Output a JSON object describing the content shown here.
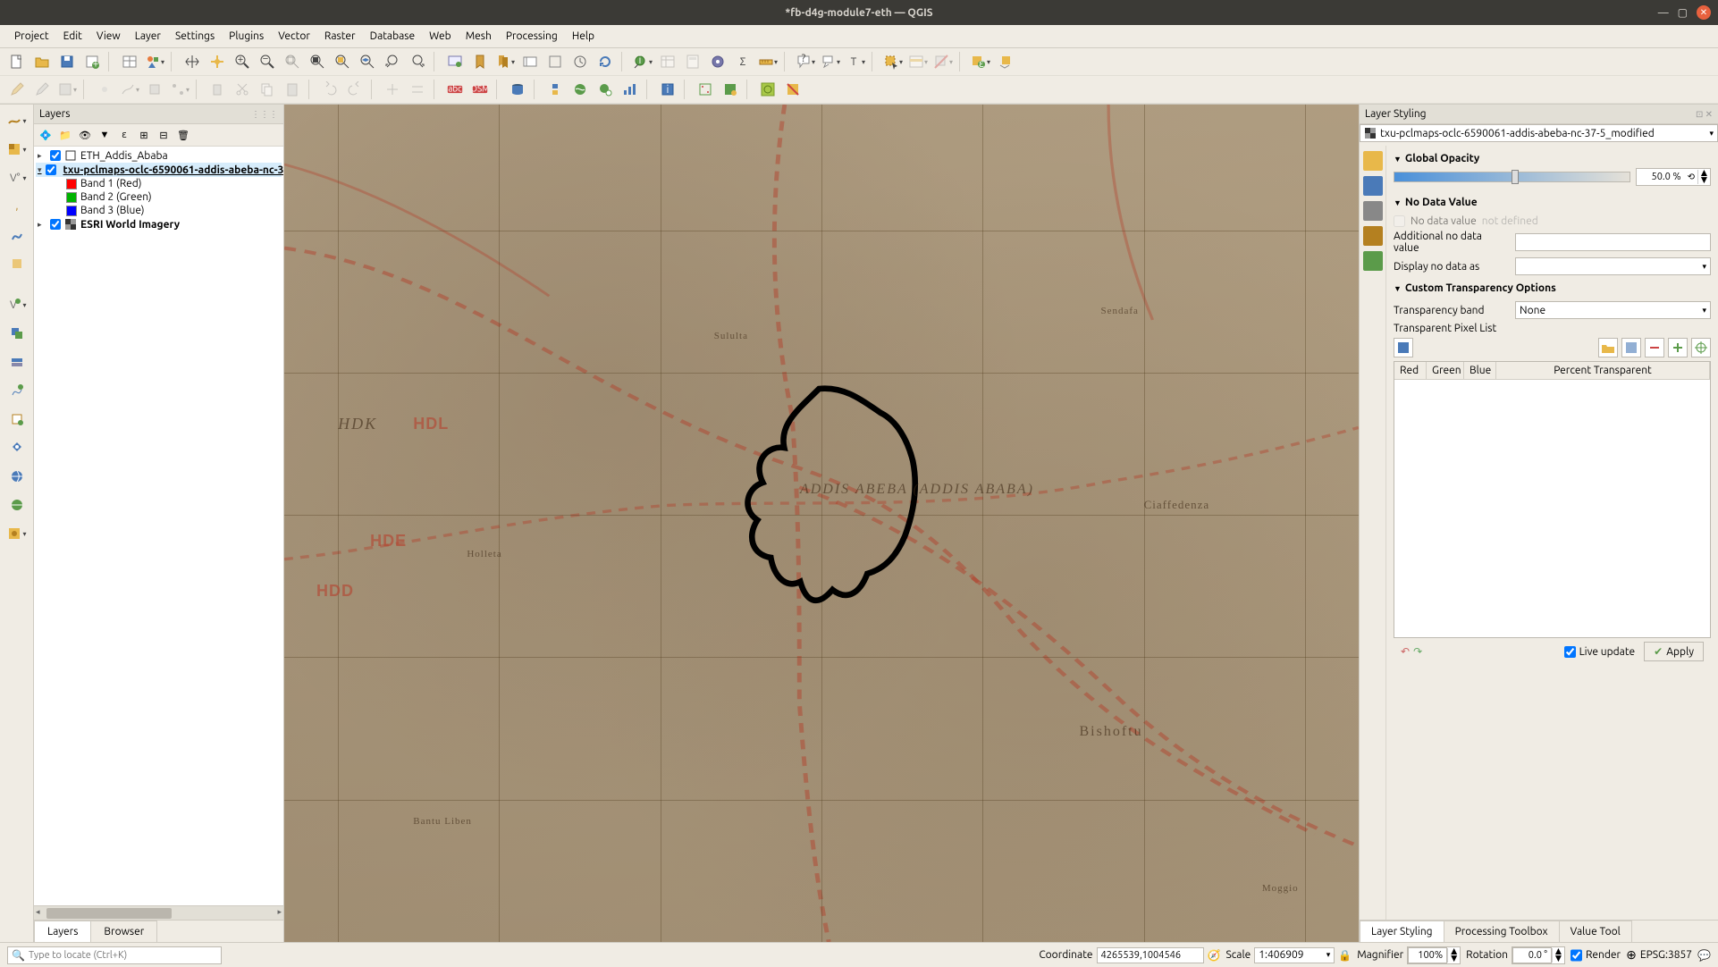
{
  "window": {
    "title": "*fb-d4g-module7-eth — QGIS"
  },
  "menu": [
    "Project",
    "Edit",
    "View",
    "Layer",
    "Settings",
    "Plugins",
    "Vector",
    "Raster",
    "Database",
    "Web",
    "Mesh",
    "Processing",
    "Help"
  ],
  "layers_panel": {
    "title": "Layers",
    "tree": [
      {
        "name": "ETH_Addis_Ababa",
        "checked": true,
        "type": "vector"
      },
      {
        "name": "txu-pclmaps-oclc-6590061-addis-abeba-nc-37-5_modified",
        "checked": true,
        "selected": true,
        "type": "raster",
        "bands": [
          {
            "label": "Band 1 (Red)",
            "color": "#ff0000"
          },
          {
            "label": "Band 2 (Green)",
            "color": "#00b300"
          },
          {
            "label": "Band 3 (Blue)",
            "color": "#0000ff"
          }
        ]
      },
      {
        "name": "ESRI World Imagery",
        "checked": true,
        "type": "raster"
      }
    ],
    "tabs": {
      "layers": "Layers",
      "browser": "Browser"
    }
  },
  "map": {
    "labels": {
      "addis": "ADDIS ABEBA   (ADDIS ABABA)",
      "bishoftu": "Bishoftu",
      "sendafa": "Sendafa",
      "moggio": "Moggio",
      "hdk": "HDK",
      "hdl": "HDL",
      "hde": "HDE",
      "hdd": "HDD",
      "holleta": "Holleta",
      "sululta": "Sululta",
      "ciaffedenza": "Ciaffedenza",
      "bantu": "Bantu Liben"
    }
  },
  "style_panel": {
    "title": "Layer Styling",
    "layer": "txu-pclmaps-oclc-6590061-addis-abeba-nc-37-5_modified",
    "sections": {
      "opacity": {
        "title": "Global Opacity",
        "value": "50.0 %",
        "slider_pct": 50
      },
      "nodata": {
        "title": "No Data Value",
        "checkbox_label": "No data value",
        "checkbox_note": "not defined",
        "additional_label": "Additional no data value",
        "display_label": "Display no data as"
      },
      "custom": {
        "title": "Custom Transparency Options",
        "band_label": "Transparency band",
        "band_value": "None",
        "list_label": "Transparent Pixel List",
        "columns": {
          "red": "Red",
          "green": "Green",
          "blue": "Blue",
          "percent": "Percent Transparent"
        }
      }
    },
    "footer": {
      "live_update": "Live update",
      "apply": "Apply"
    },
    "tabs": {
      "styling": "Layer Styling",
      "toolbox": "Processing Toolbox",
      "value": "Value Tool"
    }
  },
  "statusbar": {
    "search_placeholder": "Type to locate (Ctrl+K)",
    "coordinate_label": "Coordinate",
    "coordinate": "4265539,1004546",
    "scale_label": "Scale",
    "scale": "1:406909",
    "magnifier_label": "Magnifier",
    "magnifier": "100%",
    "rotation_label": "Rotation",
    "rotation": "0.0 °",
    "render_label": "Render",
    "epsg": "EPSG:3857"
  }
}
